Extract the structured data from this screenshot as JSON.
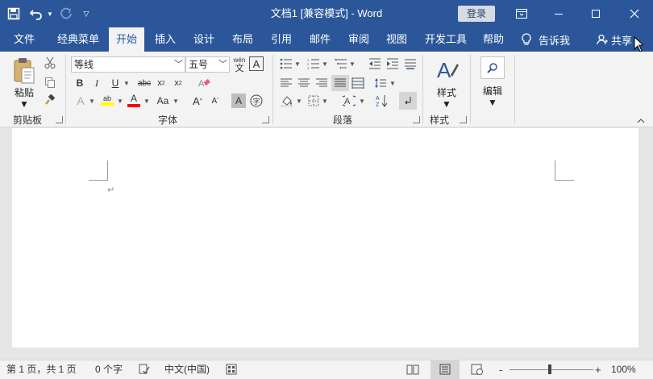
{
  "title_bar": {
    "document_title": "文档1 [兼容模式]  -  Word",
    "login_label": "登录",
    "qat_icons": [
      "save-icon",
      "undo-icon",
      "redo-icon",
      "customize-qat-icon"
    ],
    "window_icons": [
      "ribbon-display-options-icon",
      "minimize-icon",
      "maximize-icon",
      "close-icon"
    ]
  },
  "tabs": [
    {
      "label": "文件"
    },
    {
      "label": "经典菜单"
    },
    {
      "label": "开始",
      "active": true
    },
    {
      "label": "插入"
    },
    {
      "label": "设计"
    },
    {
      "label": "布局"
    },
    {
      "label": "引用"
    },
    {
      "label": "邮件"
    },
    {
      "label": "审阅"
    },
    {
      "label": "视图"
    },
    {
      "label": "开发工具"
    },
    {
      "label": "帮助"
    }
  ],
  "tell_me": "告诉我",
  "share": "共享",
  "ribbon": {
    "clipboard": {
      "paste_label": "粘贴",
      "group_label": "剪贴板"
    },
    "font": {
      "font_name": "等线",
      "font_size": "五号",
      "group_label": "字体",
      "wen_label": "wén",
      "wen_char": "文"
    },
    "paragraph": {
      "group_label": "段落"
    },
    "styles": {
      "styles_label": "样式",
      "group_label": "样式"
    },
    "editing": {
      "edit_label": "编辑"
    }
  },
  "status_bar": {
    "page_info": "第 1 页，共 1 页",
    "word_count": "0 个字",
    "language": "中文(中国)",
    "zoom": "100%",
    "zoom_minus": "-",
    "zoom_plus": "+"
  },
  "colors": {
    "brand": "#2b579a",
    "highlight": "#ffff00",
    "font_color": "#ff0000"
  }
}
